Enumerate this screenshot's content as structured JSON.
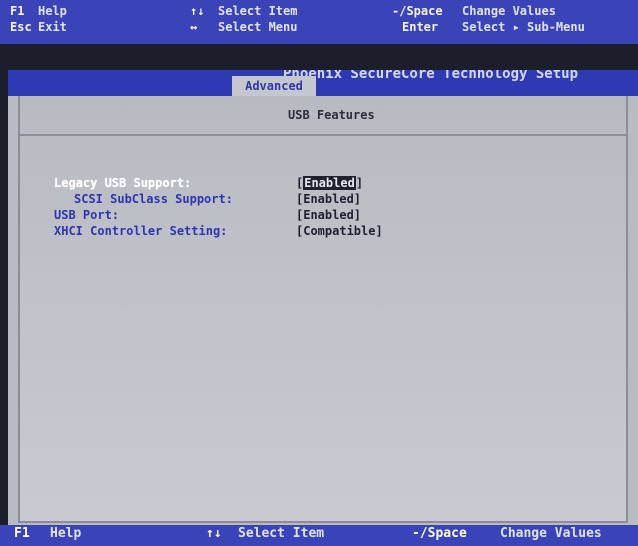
{
  "top_help": {
    "row1": {
      "key1": "F1",
      "desc1": "Help",
      "key2": "↑↓",
      "desc2": "Select Item",
      "key3": "-/Space",
      "desc3": "Change Values"
    },
    "row2": {
      "key1": "Esc",
      "desc1": "Exit",
      "key2": "↔",
      "desc2": "Select Menu",
      "key3": "Enter",
      "desc3": "Select ▸ Sub-Menu"
    }
  },
  "title_bar": {
    "title": "Phoenix SecureCore Technology Setup",
    "active_tab": "Advanced"
  },
  "section": {
    "title": "USB Features"
  },
  "settings": [
    {
      "label": "Legacy USB Support:",
      "value": "Enabled",
      "selected": true
    },
    {
      "label": "SCSI SubClass Support:",
      "value": "[Enabled]",
      "selected": false
    },
    {
      "label": "USB Port:",
      "value": "[Enabled]",
      "selected": false
    },
    {
      "label": "XHCI Controller Setting:",
      "value": "[Compatible]",
      "selected": false
    }
  ],
  "bottom_help": {
    "key1": "F1",
    "desc1": "Help",
    "key2": "↑↓",
    "desc2": "Select Item",
    "key3": "-/Space",
    "desc3": "Change Values"
  },
  "colors": {
    "help_bar": "#3a43b8",
    "screen_bg": "#b9bbc3",
    "label_blue": "#2c35b0",
    "highlight": "#ffffff"
  }
}
